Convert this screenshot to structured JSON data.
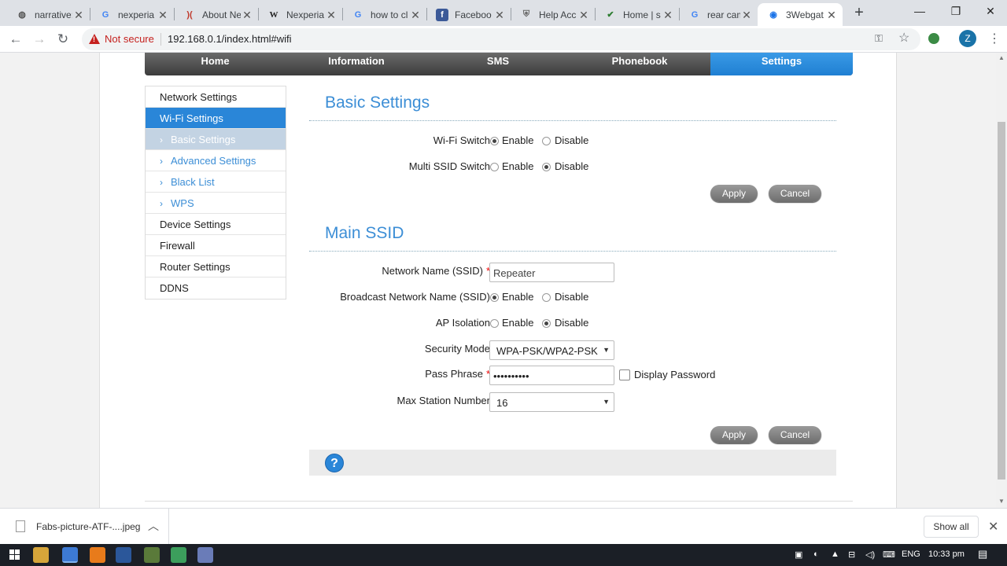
{
  "browser": {
    "tabs": [
      {
        "label": "narrative:",
        "icon": "chrome-logo-icon"
      },
      {
        "label": "nexperia",
        "icon": "google-g-icon"
      },
      {
        "label": "About Ne",
        "icon": "xing-x-icon"
      },
      {
        "label": "Nexperia",
        "icon": "wikipedia-w-icon"
      },
      {
        "label": "how to cl",
        "icon": "google-g-icon"
      },
      {
        "label": "Faceboo",
        "icon": "facebook-f-icon"
      },
      {
        "label": "Help Acc",
        "icon": "site-shield-icon"
      },
      {
        "label": "Home | s",
        "icon": "checkmark-logo-icon"
      },
      {
        "label": "rear cam",
        "icon": "google-g-icon"
      },
      {
        "label": "3Webgat",
        "icon": "globe-icon",
        "active": true
      }
    ],
    "security_label": "Not secure",
    "url": "192.168.0.1/index.html#wifi",
    "profile_initial": "Z"
  },
  "nav": {
    "items": [
      "Home",
      "Information",
      "SMS",
      "Phonebook",
      "Settings"
    ],
    "active": "Settings"
  },
  "sidebar": {
    "items": [
      {
        "label": "Network Settings"
      },
      {
        "label": "Wi-Fi Settings",
        "active": true
      },
      {
        "label": "Basic Settings",
        "sub": true,
        "active": true
      },
      {
        "label": "Advanced Settings",
        "sub": true
      },
      {
        "label": "Black List",
        "sub": true
      },
      {
        "label": "WPS",
        "sub": true
      },
      {
        "label": "Device Settings"
      },
      {
        "label": "Firewall"
      },
      {
        "label": "Router Settings"
      },
      {
        "label": "DDNS"
      }
    ]
  },
  "basic": {
    "title": "Basic Settings",
    "wifi_switch": {
      "label": "Wi-Fi Switch",
      "enable": "Enable",
      "disable": "Disable",
      "value": "Enable"
    },
    "multi_ssid": {
      "label": "Multi SSID Switch",
      "enable": "Enable",
      "disable": "Disable",
      "value": "Disable"
    },
    "apply": "Apply",
    "cancel": "Cancel"
  },
  "main_ssid": {
    "title": "Main SSID",
    "ssid": {
      "label": "Network Name (SSID)",
      "value": "Repeater"
    },
    "broadcast": {
      "label": "Broadcast Network Name (SSID)",
      "enable": "Enable",
      "disable": "Disable",
      "value": "Enable"
    },
    "ap_isolation": {
      "label": "AP Isolation",
      "enable": "Enable",
      "disable": "Disable",
      "value": "Disable"
    },
    "security_mode": {
      "label": "Security Mode",
      "value": "WPA-PSK/WPA2-PSK"
    },
    "pass_phrase": {
      "label": "Pass Phrase",
      "value": "••••••••••",
      "display_password": "Display Password"
    },
    "max_station": {
      "label": "Max Station Number",
      "value": "16"
    },
    "apply": "Apply",
    "cancel": "Cancel"
  },
  "required_mark": "*",
  "downloads": {
    "file": "Fabs-picture-ATF-....jpeg",
    "show_all": "Show all"
  },
  "taskbar": {
    "lang": "ENG",
    "time": "10:33 pm"
  }
}
